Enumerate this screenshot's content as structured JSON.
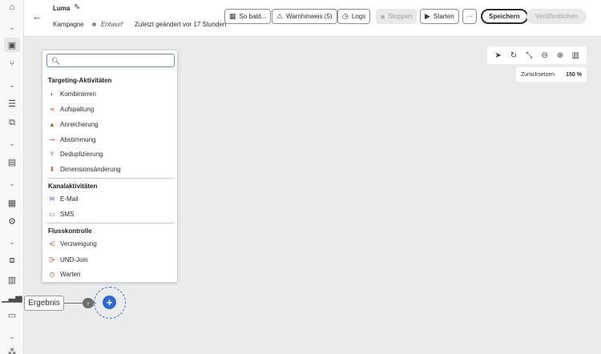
{
  "header": {
    "title": "Luma",
    "object_type": "Kampagne",
    "status": "Entwurf",
    "modified": "Zuletzt geändert vor 17 Stunden",
    "buttons": {
      "schedule": "So bald...",
      "warnings": "Warnhinweis (5)",
      "logs": "Logs",
      "stop": "Stoppen",
      "start": "Starten",
      "more": "···",
      "save": "Speichern",
      "publish": "Veröffentlichen"
    }
  },
  "canvas": {
    "reset_label": "Zurücksetzen",
    "zoom": "150 %",
    "node_label": "Ergebnis"
  },
  "activity_menu": {
    "search_placeholder": "",
    "sections": [
      {
        "title": "Targeting-Aktivitäten",
        "items": [
          {
            "label": "Kombinieren",
            "icon": "combine-icon",
            "color": "#c8552b"
          },
          {
            "label": "Aufspaltung",
            "icon": "split-icon",
            "color": "#c8552b"
          },
          {
            "label": "Anreicherung",
            "icon": "enrichment-icon",
            "color": "#c8552b"
          },
          {
            "label": "Abstimmung",
            "icon": "reconciliation-icon",
            "color": "#c8552b"
          },
          {
            "label": "Deduplizierung",
            "icon": "deduplication-icon",
            "color": "#c8552b"
          },
          {
            "label": "Dimensionsänderung",
            "icon": "dimension-change-icon",
            "color": "#c8552b"
          }
        ]
      },
      {
        "title": "Kanalaktivitäten",
        "items": [
          {
            "label": "E-Mail",
            "icon": "email-icon",
            "color": "#4a5fc8"
          },
          {
            "label": "SMS",
            "icon": "sms-icon",
            "color": "#4a5fc8"
          }
        ]
      },
      {
        "title": "Flusskontrolle",
        "items": [
          {
            "label": "Verzweigung",
            "icon": "fork-icon",
            "color": "#b4541f"
          },
          {
            "label": "UND-Join",
            "icon": "and-join-icon",
            "color": "#b4541f"
          },
          {
            "label": "Warten",
            "icon": "wait-icon",
            "color": "#b4541f"
          }
        ]
      }
    ]
  }
}
